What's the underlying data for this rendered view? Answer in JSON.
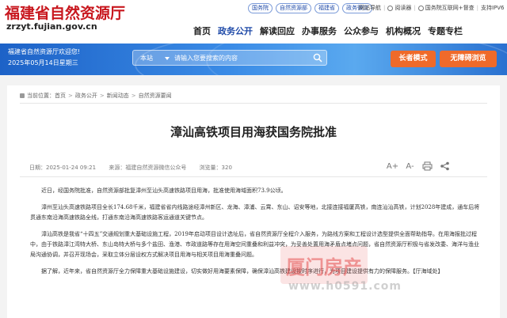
{
  "header": {
    "site_title": "福建省自然资源厅",
    "domain": "zrzyt.fujian.gov.cn",
    "chips": [
      "国务院",
      "自然资源部",
      "福建省",
      "政务微信"
    ],
    "top_links": [
      "网站导航",
      "|",
      "阅读器",
      "|",
      "国务院互联网+督查",
      "|",
      "支持IPV6"
    ],
    "nav": [
      "首页",
      "政务公开",
      "解读回应",
      "办事服务",
      "公众参与",
      "机构概况",
      "专题专栏"
    ],
    "active_nav": "政务公开"
  },
  "hero": {
    "welcome": "福建省自然资源厅欢迎您!",
    "date": "2025年05月14日星期三",
    "search_scope": "本站",
    "search_placeholder": "请输入您要搜索的内容",
    "elder_mode": "长者模式",
    "accessible": "无障碍浏览"
  },
  "breadcrumb": [
    "当前位置：",
    "首页",
    "政务公开",
    "新闻动态",
    "自然资源要闻"
  ],
  "article": {
    "title": "漳汕高铁项目用海获国务院批准",
    "date": "日期：2025-01-24 09:21",
    "source": "来源：福建自然资源微信公众号",
    "views": "浏览量：320",
    "tools": [
      "A+",
      "A-",
      "print",
      "share"
    ],
    "paragraphs": [
      "近日，经国务院批准，自然资源部批复漳州至汕头高速铁路项目用海，批准使用海域面积73.9公顷。",
      "漳州至汕头高速铁路项目全长174.68千米，福建省省内线路途经漳州新区、龙海、漳浦、云霄、东山、诏安等地，北接连接福厦高铁，南连汕汕高铁，计划2028年建成，通车后将贯通东南沿海高速铁路全线，打通东南沿海高速铁路客运通道关键节点。",
      "漳汕高铁是我省“十四五”交通规划重大基础设施工程，2019年启动项目设计选址后，省自然资源厅全程介入服务，为路线方案和工程设计选型提供全面帮助指导。在用海报批过程中，由于铁路漳江湾特大桥、东山岛特大桥与多个盐田、渔港、市政道路等存在用海空间重叠和利益冲突，为妥善处置用海矛盾点堵点问题，省自然资源厅积极与省发改委、海洋与渔业局沟通协调，并召开现场会，采取立体分层设权方式解决项目用海与相关项目用海重叠问题。",
      "据了解，近年来，省自然资源厅全力保障重大基础设施建设，切实做好用海要素保障，确保漳汕高铁建设按时序进行，为项目建设提供有力的保障服务。【厅海域处】"
    ]
  },
  "watermark": {
    "brand": "厦门房产",
    "url": "www.h0591.com"
  }
}
